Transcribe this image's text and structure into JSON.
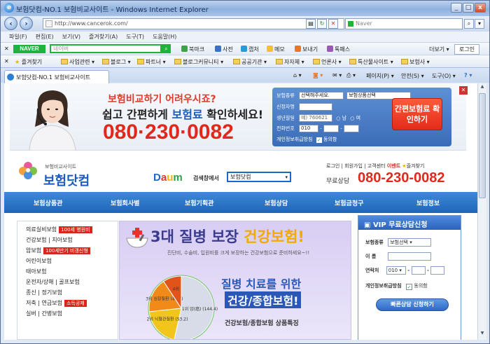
{
  "window": {
    "title": "보험닷컴-NO.1 보험비교사이트 - Windows Internet Explorer"
  },
  "address": {
    "url": "http://www.cancerok.com/",
    "search_placeholder": "Naver"
  },
  "menu": [
    "파일(F)",
    "편집(E)",
    "보기(V)",
    "즐겨찾기(A)",
    "도구(T)",
    "도움말(H)"
  ],
  "naver_toolbar": {
    "logo": "NAVER",
    "placeholder": "네이버",
    "items": [
      "북마크",
      "사전",
      "캡처",
      "메모",
      "보내기",
      "톡패스"
    ],
    "more": "더보기",
    "login": "로그인"
  },
  "favorites": {
    "label": "즐겨찾기",
    "items": [
      "사업관련",
      "블로그",
      "파트너",
      "블로그커뮤니티",
      "공공기관",
      "자자체",
      "언론사",
      "특산물사이트",
      "보험사"
    ]
  },
  "tab": {
    "title": "보험닷컴-NO.1 보험비교사이트"
  },
  "tab_tools": {
    "page": "페이지(P)",
    "safety": "안전(S)",
    "tools": "도구(O)"
  },
  "banner": {
    "headline": "보험비교하기 어려우시죠?",
    "subline_pre": "쉽고 간편하게 ",
    "subline_em": "보험료",
    "subline_post": " 확인하세요!",
    "phone": "080·230·0082",
    "form": {
      "type_label": "보험종류",
      "type_value": "선택해주세요.",
      "product_value": "보험상품선택",
      "name_label": "신청자명",
      "birth_label": "생년월일",
      "birth_value": "예) 760621",
      "male": "남",
      "female": "여",
      "phone_label": "전화번호",
      "phone_value": "010",
      "privacy_label": "개인정보취급방침",
      "agree": "동의함",
      "cta": "간편보험료 확인하기"
    }
  },
  "header": {
    "logo_sub": "보험비교사이트",
    "logo_main": "보험닷컴",
    "daum": "Daum",
    "search_label": "검색창에서",
    "search_value": "보험닷컴",
    "util": [
      "로그인",
      "회원가입",
      "고객센터",
      "이벤트",
      "즐겨찾기"
    ],
    "phone_label": "무료상담",
    "phone": "080-230-0082"
  },
  "nav": [
    "보험상품관",
    "보험회사별",
    "보험기획관",
    "보험상담",
    "보험금청구",
    "보험정보"
  ],
  "left_menu": [
    {
      "label": "의료실비보험",
      "tag": "100세 병원비"
    },
    {
      "label": "건강보험 | 치아보험",
      "tag": ""
    },
    {
      "label": "암보험",
      "tag": "100세만기 비갱신형"
    },
    {
      "label": "어린이보험",
      "tag": ""
    },
    {
      "label": "태아보험",
      "tag": ""
    },
    {
      "label": "운전자/상해 | 골프보험",
      "tag": ""
    },
    {
      "label": "종신 | 정기보험",
      "tag": ""
    },
    {
      "label": "저축 | 연금보험",
      "tag": "소득공제"
    },
    {
      "label": "실버 | 간병보험",
      "tag": ""
    }
  ],
  "promo": {
    "title_pre": "3대 질병 보장 ",
    "title_em": "건강보험!",
    "sub": "진단비, 수술비, 입원비를 크게 보장하는 건강보험으로 준비하세요~!!",
    "line2": "질병 치료를 위한",
    "line3": "건강/종합보험!",
    "line4": "건강보험/종합보험 상품특징"
  },
  "chart_data": {
    "type": "pie",
    "categories": [
      "1위 암(癌)",
      "2위 뇌혈관질환",
      "3위 심장질환",
      "4위 기타"
    ],
    "values": [
      144.4,
      53.2,
      46.9,
      25.0
    ],
    "labels": [
      "1위 암(癌) (144.4)",
      "2위 뇌혈관질환 (53.2)",
      "3위 심장질환 (46.9)",
      "4위"
    ]
  },
  "vip": {
    "title": "VIP 무료상담신청",
    "type_label": "보험종류",
    "type_value": "보험선택",
    "name_label": "이 름",
    "phone_label": "연락처",
    "phone_value": "010",
    "privacy_label": "개인정보취급방침",
    "agree": "동의함",
    "button": "빠른상담 신청하기"
  },
  "colors": {
    "nav_blue": "#1f64b8",
    "phone_red": "#e0281c",
    "naver_green": "#1fb33b"
  }
}
